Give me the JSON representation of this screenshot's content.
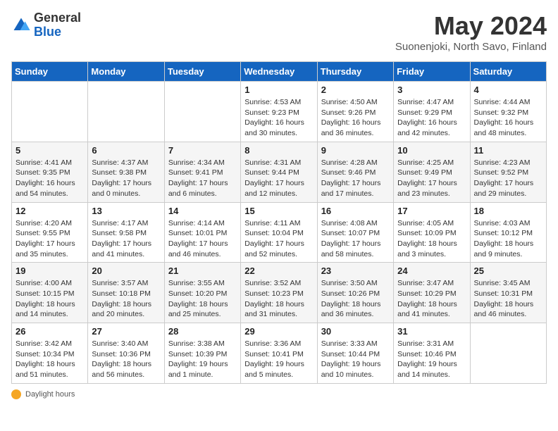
{
  "logo": {
    "general": "General",
    "blue": "Blue"
  },
  "title": "May 2024",
  "location": "Suonenjoki, North Savo, Finland",
  "days_of_week": [
    "Sunday",
    "Monday",
    "Tuesday",
    "Wednesday",
    "Thursday",
    "Friday",
    "Saturday"
  ],
  "weeks": [
    [
      {
        "day": "",
        "info": ""
      },
      {
        "day": "",
        "info": ""
      },
      {
        "day": "",
        "info": ""
      },
      {
        "day": "1",
        "info": "Sunrise: 4:53 AM\nSunset: 9:23 PM\nDaylight: 16 hours and 30 minutes."
      },
      {
        "day": "2",
        "info": "Sunrise: 4:50 AM\nSunset: 9:26 PM\nDaylight: 16 hours and 36 minutes."
      },
      {
        "day": "3",
        "info": "Sunrise: 4:47 AM\nSunset: 9:29 PM\nDaylight: 16 hours and 42 minutes."
      },
      {
        "day": "4",
        "info": "Sunrise: 4:44 AM\nSunset: 9:32 PM\nDaylight: 16 hours and 48 minutes."
      }
    ],
    [
      {
        "day": "5",
        "info": "Sunrise: 4:41 AM\nSunset: 9:35 PM\nDaylight: 16 hours and 54 minutes."
      },
      {
        "day": "6",
        "info": "Sunrise: 4:37 AM\nSunset: 9:38 PM\nDaylight: 17 hours and 0 minutes."
      },
      {
        "day": "7",
        "info": "Sunrise: 4:34 AM\nSunset: 9:41 PM\nDaylight: 17 hours and 6 minutes."
      },
      {
        "day": "8",
        "info": "Sunrise: 4:31 AM\nSunset: 9:44 PM\nDaylight: 17 hours and 12 minutes."
      },
      {
        "day": "9",
        "info": "Sunrise: 4:28 AM\nSunset: 9:46 PM\nDaylight: 17 hours and 17 minutes."
      },
      {
        "day": "10",
        "info": "Sunrise: 4:25 AM\nSunset: 9:49 PM\nDaylight: 17 hours and 23 minutes."
      },
      {
        "day": "11",
        "info": "Sunrise: 4:23 AM\nSunset: 9:52 PM\nDaylight: 17 hours and 29 minutes."
      }
    ],
    [
      {
        "day": "12",
        "info": "Sunrise: 4:20 AM\nSunset: 9:55 PM\nDaylight: 17 hours and 35 minutes."
      },
      {
        "day": "13",
        "info": "Sunrise: 4:17 AM\nSunset: 9:58 PM\nDaylight: 17 hours and 41 minutes."
      },
      {
        "day": "14",
        "info": "Sunrise: 4:14 AM\nSunset: 10:01 PM\nDaylight: 17 hours and 46 minutes."
      },
      {
        "day": "15",
        "info": "Sunrise: 4:11 AM\nSunset: 10:04 PM\nDaylight: 17 hours and 52 minutes."
      },
      {
        "day": "16",
        "info": "Sunrise: 4:08 AM\nSunset: 10:07 PM\nDaylight: 17 hours and 58 minutes."
      },
      {
        "day": "17",
        "info": "Sunrise: 4:05 AM\nSunset: 10:09 PM\nDaylight: 18 hours and 3 minutes."
      },
      {
        "day": "18",
        "info": "Sunrise: 4:03 AM\nSunset: 10:12 PM\nDaylight: 18 hours and 9 minutes."
      }
    ],
    [
      {
        "day": "19",
        "info": "Sunrise: 4:00 AM\nSunset: 10:15 PM\nDaylight: 18 hours and 14 minutes."
      },
      {
        "day": "20",
        "info": "Sunrise: 3:57 AM\nSunset: 10:18 PM\nDaylight: 18 hours and 20 minutes."
      },
      {
        "day": "21",
        "info": "Sunrise: 3:55 AM\nSunset: 10:20 PM\nDaylight: 18 hours and 25 minutes."
      },
      {
        "day": "22",
        "info": "Sunrise: 3:52 AM\nSunset: 10:23 PM\nDaylight: 18 hours and 31 minutes."
      },
      {
        "day": "23",
        "info": "Sunrise: 3:50 AM\nSunset: 10:26 PM\nDaylight: 18 hours and 36 minutes."
      },
      {
        "day": "24",
        "info": "Sunrise: 3:47 AM\nSunset: 10:29 PM\nDaylight: 18 hours and 41 minutes."
      },
      {
        "day": "25",
        "info": "Sunrise: 3:45 AM\nSunset: 10:31 PM\nDaylight: 18 hours and 46 minutes."
      }
    ],
    [
      {
        "day": "26",
        "info": "Sunrise: 3:42 AM\nSunset: 10:34 PM\nDaylight: 18 hours and 51 minutes."
      },
      {
        "day": "27",
        "info": "Sunrise: 3:40 AM\nSunset: 10:36 PM\nDaylight: 18 hours and 56 minutes."
      },
      {
        "day": "28",
        "info": "Sunrise: 3:38 AM\nSunset: 10:39 PM\nDaylight: 19 hours and 1 minute."
      },
      {
        "day": "29",
        "info": "Sunrise: 3:36 AM\nSunset: 10:41 PM\nDaylight: 19 hours and 5 minutes."
      },
      {
        "day": "30",
        "info": "Sunrise: 3:33 AM\nSunset: 10:44 PM\nDaylight: 19 hours and 10 minutes."
      },
      {
        "day": "31",
        "info": "Sunrise: 3:31 AM\nSunset: 10:46 PM\nDaylight: 19 hours and 14 minutes."
      },
      {
        "day": "",
        "info": ""
      }
    ]
  ],
  "footer": {
    "daylight_label": "Daylight hours"
  }
}
